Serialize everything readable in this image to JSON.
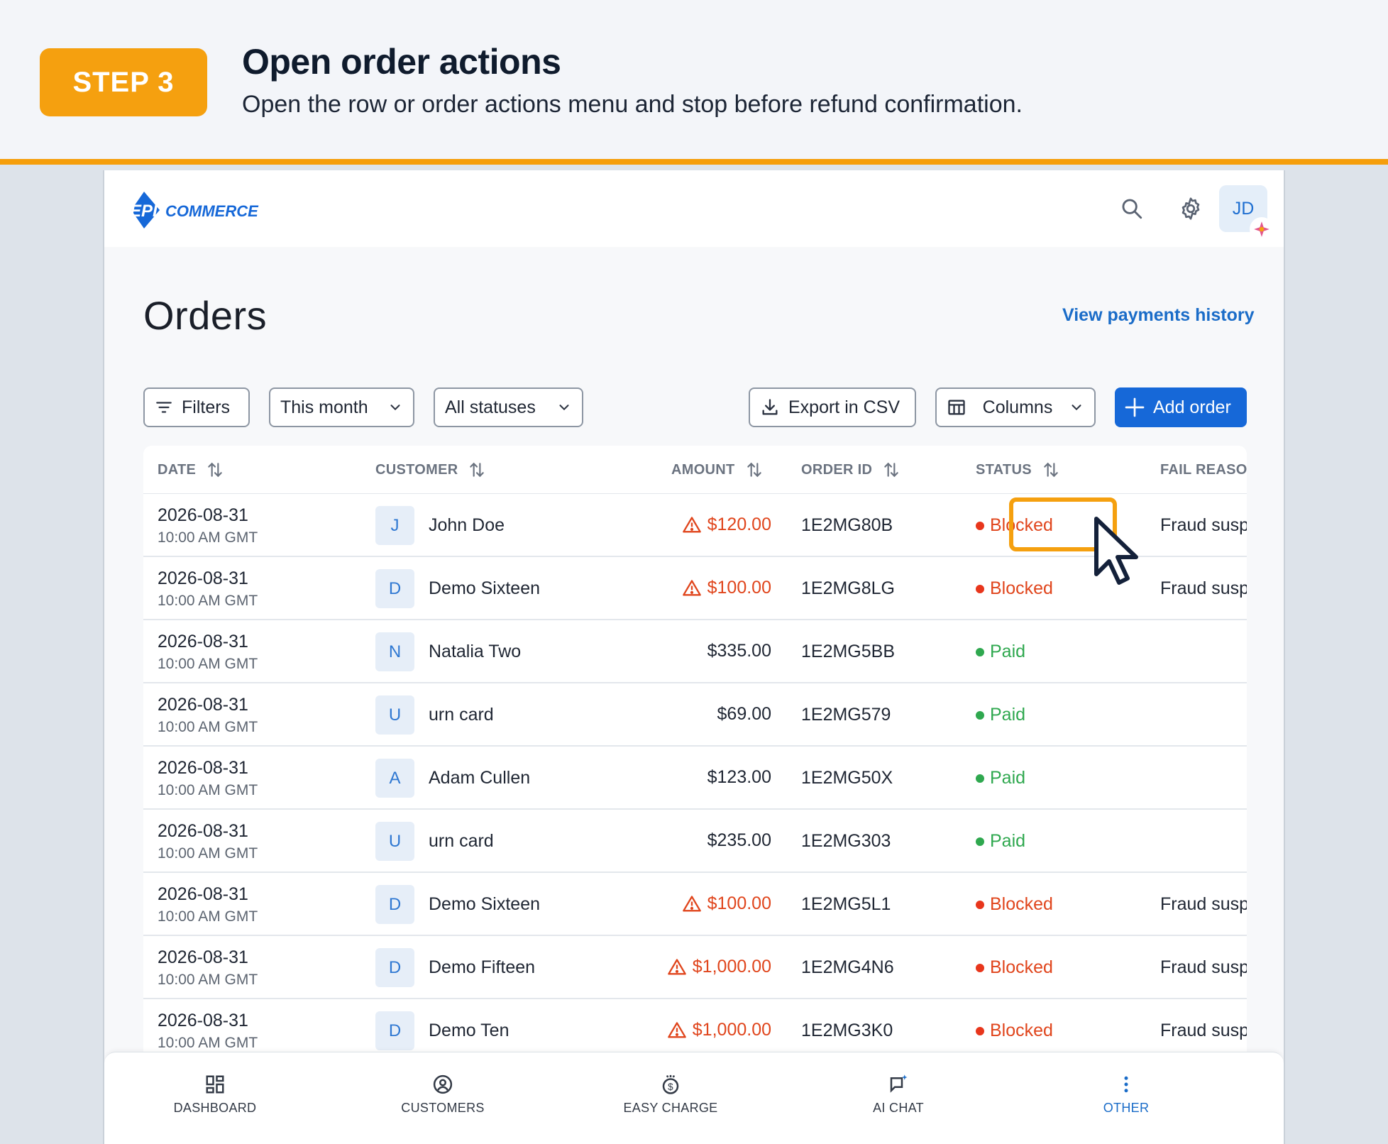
{
  "step": {
    "badge": "STEP 3",
    "title": "Open order actions",
    "description": "Open the row or order actions menu and stop before refund confirmation."
  },
  "header": {
    "logo_text": "EPD COMMERCE",
    "avatar_initials": "JD",
    "icons": [
      "search-icon",
      "gear-icon"
    ]
  },
  "page": {
    "title": "Orders",
    "payments_link": "View payments history"
  },
  "toolbar": {
    "filters_label": "Filters",
    "period_value": "This month",
    "status_value": "All statuses",
    "export_label": "Export in CSV",
    "columns_label": "Columns",
    "add_label": "Add order"
  },
  "table": {
    "columns": {
      "date": "DATE",
      "customer": "CUSTOMER",
      "amount": "AMOUNT",
      "order_id": "ORDER ID",
      "status": "STATUS",
      "fail_reason": "FAIL REASON"
    },
    "rows": [
      {
        "date": "2026-08-31",
        "time": "10:00 AM GMT",
        "initial": "J",
        "customer": "John Doe",
        "amount": "$120.00",
        "warn": true,
        "order_id": "1E2MG80B",
        "status": "Blocked",
        "fail_reason": "Fraud suspected"
      },
      {
        "date": "2026-08-31",
        "time": "10:00 AM GMT",
        "initial": "D",
        "customer": "Demo Sixteen",
        "amount": "$100.00",
        "warn": true,
        "order_id": "1E2MG8LG",
        "status": "Blocked",
        "fail_reason": "Fraud suspected"
      },
      {
        "date": "2026-08-31",
        "time": "10:00 AM GMT",
        "initial": "N",
        "customer": "Natalia Two",
        "amount": "$335.00",
        "warn": false,
        "order_id": "1E2MG5BB",
        "status": "Paid",
        "fail_reason": ""
      },
      {
        "date": "2026-08-31",
        "time": "10:00 AM GMT",
        "initial": "U",
        "customer": "urn card",
        "amount": "$69.00",
        "warn": false,
        "order_id": "1E2MG579",
        "status": "Paid",
        "fail_reason": ""
      },
      {
        "date": "2026-08-31",
        "time": "10:00 AM GMT",
        "initial": "A",
        "customer": "Adam Cullen",
        "amount": "$123.00",
        "warn": false,
        "order_id": "1E2MG50X",
        "status": "Paid",
        "fail_reason": ""
      },
      {
        "date": "2026-08-31",
        "time": "10:00 AM GMT",
        "initial": "U",
        "customer": "urn card",
        "amount": "$235.00",
        "warn": false,
        "order_id": "1E2MG303",
        "status": "Paid",
        "fail_reason": ""
      },
      {
        "date": "2026-08-31",
        "time": "10:00 AM GMT",
        "initial": "D",
        "customer": "Demo Sixteen",
        "amount": "$100.00",
        "warn": true,
        "order_id": "1E2MG5L1",
        "status": "Blocked",
        "fail_reason": "Fraud suspected"
      },
      {
        "date": "2026-08-31",
        "time": "10:00 AM GMT",
        "initial": "D",
        "customer": "Demo Fifteen",
        "amount": "$1,000.00",
        "warn": true,
        "order_id": "1E2MG4N6",
        "status": "Blocked",
        "fail_reason": "Fraud suspected"
      },
      {
        "date": "2026-08-31",
        "time": "10:00 AM GMT",
        "initial": "D",
        "customer": "Demo Ten",
        "amount": "$1,000.00",
        "warn": true,
        "order_id": "1E2MG3K0",
        "status": "Blocked",
        "fail_reason": "Fraud suspected"
      }
    ]
  },
  "bottom_nav": {
    "items": [
      {
        "label": "DASHBOARD",
        "icon": "dashboard-icon",
        "active": false
      },
      {
        "label": "CUSTOMERS",
        "icon": "customers-icon",
        "active": false
      },
      {
        "label": "EASY CHARGE",
        "icon": "easy-charge-icon",
        "active": false
      },
      {
        "label": "AI CHAT",
        "icon": "ai-chat-icon",
        "active": false
      },
      {
        "label": "OTHER",
        "icon": "more-vertical-icon",
        "active": true
      }
    ]
  },
  "colors": {
    "accent": "#f5a00f",
    "primary": "#1668d8",
    "blocked": "#e0451c",
    "paid": "#2fa84f"
  }
}
